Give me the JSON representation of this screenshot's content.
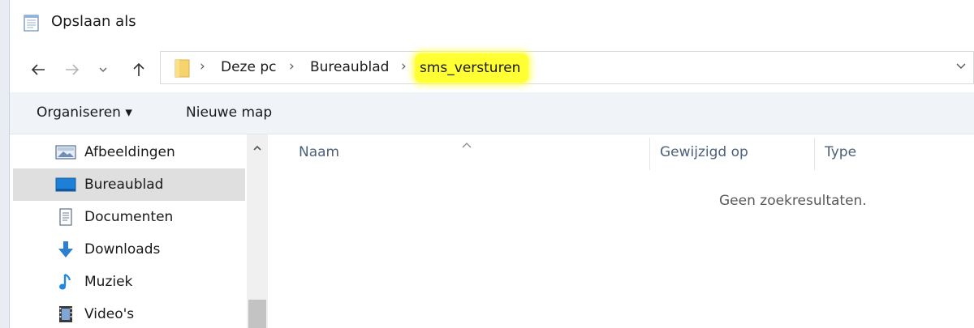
{
  "window": {
    "title": "Opslaan als",
    "icon": "notepad-icon"
  },
  "nav": {
    "back_icon": "arrow-left-icon",
    "forward_icon": "arrow-right-icon",
    "recent_icon": "chevron-down-icon",
    "up_icon": "arrow-up-icon"
  },
  "address": {
    "breadcrumbs": [
      "Deze pc",
      "Bureaublad",
      "sms_versturen"
    ],
    "highlight_color": "#ffff33"
  },
  "toolbar": {
    "organize_label": "Organiseren ▾",
    "new_folder_label": "Nieuwe map"
  },
  "sidebar": {
    "items": [
      {
        "label": "Afbeeldingen",
        "icon": "pictures-icon",
        "selected": false
      },
      {
        "label": "Bureaublad",
        "icon": "desktop-icon",
        "selected": true
      },
      {
        "label": "Documenten",
        "icon": "documents-icon",
        "selected": false
      },
      {
        "label": "Downloads",
        "icon": "downloads-icon",
        "selected": false
      },
      {
        "label": "Muziek",
        "icon": "music-icon",
        "selected": false
      },
      {
        "label": "Video's",
        "icon": "videos-icon",
        "selected": false
      }
    ]
  },
  "files": {
    "columns": [
      "Naam",
      "Gewijzigd op",
      "Type"
    ],
    "empty_message": "Geen zoekresultaten."
  }
}
